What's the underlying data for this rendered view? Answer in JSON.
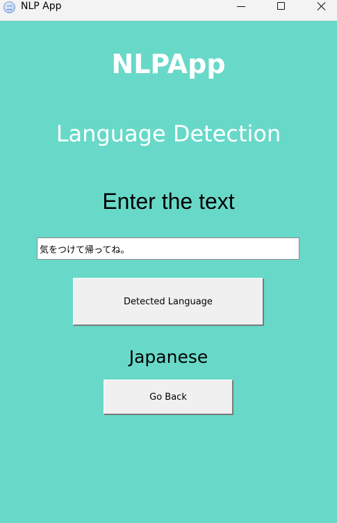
{
  "window": {
    "title": "NLP App",
    "icon": "nlp-app-icon",
    "controls": [
      "minimize-icon",
      "maximize-icon",
      "close-icon"
    ]
  },
  "colors": {
    "background": "#68d9c8",
    "titlebar": "#f3f3f3",
    "heading_text": "#ffffff",
    "button_face": "#f0f0f0"
  },
  "header": {
    "app_name": "NLPApp",
    "subtitle": "Language Detection"
  },
  "form": {
    "prompt": "Enter the text",
    "input_value": "気をつけて帰ってね。",
    "detect_button_label": "Detected Language"
  },
  "result": {
    "language": "Japanese"
  },
  "nav": {
    "back_button_label": "Go Back"
  }
}
